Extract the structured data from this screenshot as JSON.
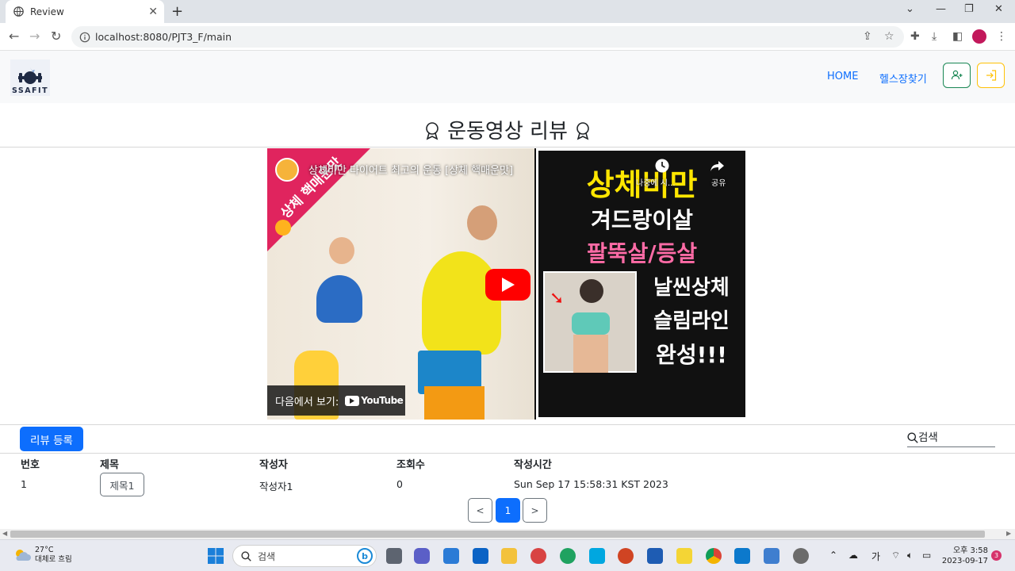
{
  "browser": {
    "tab_title": "Review",
    "url": "localhost:8080/PJT3_F/main"
  },
  "navbar": {
    "logo_text": "SSAFIT",
    "home_label": "HOME",
    "gym_label": "헬스장찾기"
  },
  "page": {
    "heading": "운동영상 리뷰"
  },
  "video": {
    "title": "상체비만 다이어트 최고의 운동 [상체 핵매운맛]",
    "badge_text": "상체 핵매운맛",
    "watch_later": "나중에 시...",
    "share": "공유",
    "watch_on_label": "다음에서 보기:",
    "youtube_label": "YouTube",
    "thumb_lines": [
      "상체비만",
      "겨드랑이살",
      "팔뚝살/등살",
      "날씬상체",
      "슬림라인",
      "완성!!!"
    ]
  },
  "toolbar": {
    "register_label": "리뷰 등록",
    "search_placeholder": "검색"
  },
  "table": {
    "headers": [
      "번호",
      "제목",
      "작성자",
      "조회수",
      "작성시간"
    ],
    "rows": [
      {
        "no": "1",
        "title": "제목1",
        "writer": "작성자1",
        "views": "0",
        "time": "Sun Sep 17 15:58:31 KST 2023"
      }
    ]
  },
  "pagination": {
    "prev": "<",
    "current": "1",
    "next": ">"
  },
  "taskbar": {
    "temperature": "27°C",
    "weather": "대체로 흐림",
    "search_label": "검색",
    "ime": "가",
    "time": "오후 3:58",
    "date": "2023-09-17",
    "notification_count": "3"
  }
}
